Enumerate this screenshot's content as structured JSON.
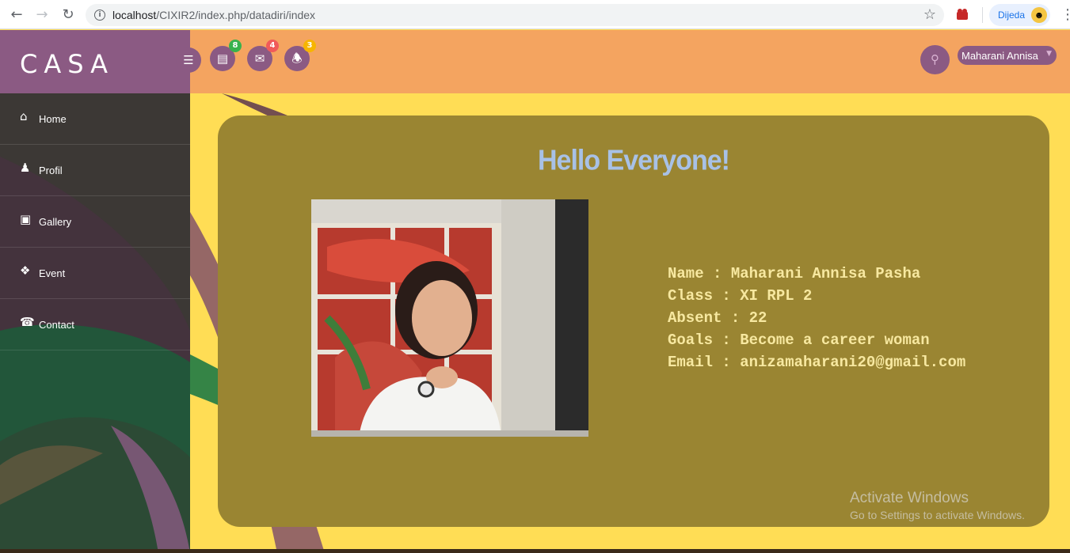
{
  "browser": {
    "url_host": "localhost",
    "url_path": "/CIXIR2/index.php/datadiri/index",
    "profile_label": "Dijeda",
    "back_icon": "arrow-left-icon",
    "forward_icon": "arrow-right-icon",
    "reload_icon": "reload-icon",
    "star_icon": "star-icon"
  },
  "header": {
    "logo": "CASA",
    "toolbar_badges": [
      {
        "icon": "tasks-icon",
        "count": "8",
        "color": "#37b24d"
      },
      {
        "icon": "envelope-icon",
        "count": "4",
        "color": "#f05a5a"
      },
      {
        "icon": "bell-icon",
        "count": "3",
        "color": "#f7b500"
      }
    ],
    "user_name": "Maharani Annisa"
  },
  "sidebar": {
    "items": [
      {
        "label": "Home",
        "icon": "home-icon"
      },
      {
        "label": "Profil",
        "icon": "user-icon"
      },
      {
        "label": "Gallery",
        "icon": "camera-icon"
      },
      {
        "label": "Event",
        "icon": "gift-icon"
      },
      {
        "label": "Contact",
        "icon": "phone-icon"
      }
    ]
  },
  "main": {
    "title": "Hello Everyone!",
    "info": {
      "name": "Name : Maharani Annisa Pasha",
      "class": "Class : XI RPL 2",
      "absent": "Absent : 22",
      "goals": "Goals : Become a career woman",
      "email": "Email : anizamaharani20@gmail.com"
    }
  },
  "watermark": {
    "line1": "Activate Windows",
    "line2": "Go to Settings to activate Windows."
  },
  "colors": {
    "header_bg": "#f4a460",
    "logo_bg": "#8b5a83",
    "page_bg": "#ffdd55",
    "card_bg": "#9a8532",
    "sidebar_bg": "#3c3835",
    "title_color": "#a8c1e6",
    "info_color": "#f7e8a0"
  }
}
